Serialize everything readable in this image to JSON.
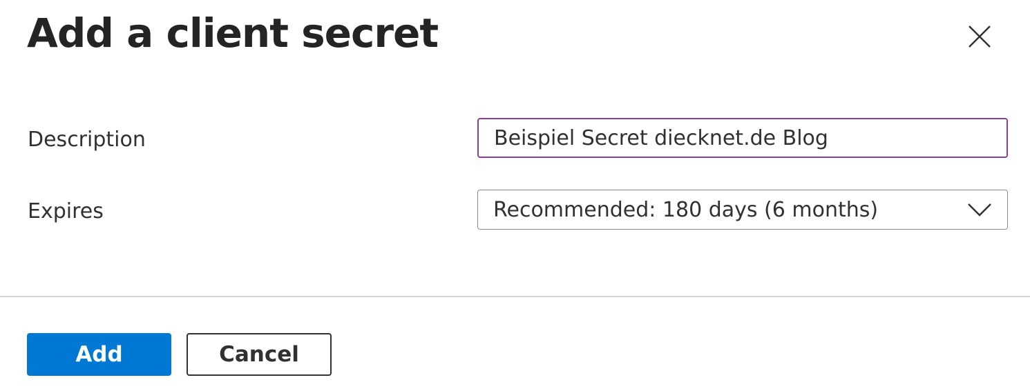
{
  "dialog": {
    "title": "Add a client secret",
    "close_icon": "close-icon"
  },
  "form": {
    "description_label": "Description",
    "description_value": "Beispiel Secret diecknet.de Blog",
    "expires_label": "Expires",
    "expires_value": "Recommended: 180 days (6 months)"
  },
  "buttons": {
    "add": "Add",
    "cancel": "Cancel"
  },
  "colors": {
    "primary": "#0078d4",
    "focus_border": "#8a3d9c"
  }
}
